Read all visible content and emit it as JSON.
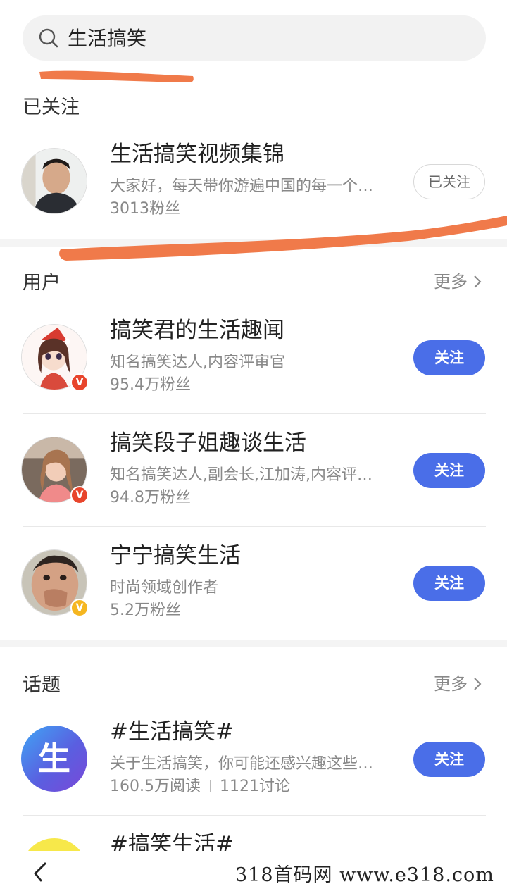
{
  "search": {
    "query": "生活搞笑"
  },
  "followed": {
    "title": "已关注",
    "item": {
      "name": "生活搞笑视频集锦",
      "desc": "大家好，每天带你游遍中国的每一个…",
      "fans": "3013粉丝",
      "button": "已关注"
    }
  },
  "users": {
    "title": "用户",
    "more": "更多",
    "items": [
      {
        "name": "搞笑君的生活趣闻",
        "desc": "知名搞笑达人,内容评审官",
        "fans": "95.4万粉丝",
        "button": "关注",
        "badge": "V"
      },
      {
        "name": "搞笑段子姐趣谈生活",
        "desc": "知名搞笑达人,副会长,江加涛,内容评…",
        "fans": "94.8万粉丝",
        "button": "关注",
        "badge": "V"
      },
      {
        "name": "宁宁搞笑生活",
        "desc": "时尚领域创作者",
        "fans": "5.2万粉丝",
        "button": "关注",
        "badge": "V"
      }
    ]
  },
  "topics": {
    "title": "话题",
    "more": "更多",
    "items": [
      {
        "name": "#生活搞笑#",
        "desc": "关于生活搞笑，你可能还感兴趣这些…",
        "reads": "160.5万阅读",
        "discuss": "1121讨论",
        "button": "关注",
        "icon_char": "生"
      },
      {
        "name": "#搞笑生活#"
      }
    ]
  },
  "watermark": "318首码网  www.e318.com",
  "colors": {
    "accent": "#4a6ee8",
    "scribble": "#f07a4a",
    "badge_red": "#e8452c",
    "badge_gold": "#f5b620"
  }
}
